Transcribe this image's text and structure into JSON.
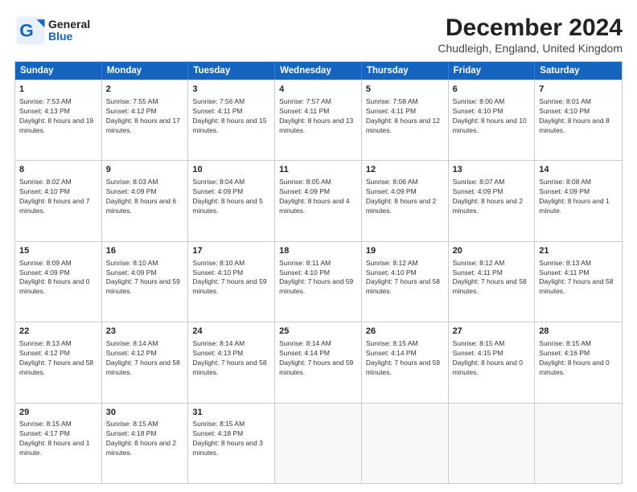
{
  "header": {
    "logo_general": "General",
    "logo_blue": "Blue",
    "main_title": "December 2024",
    "subtitle": "Chudleigh, England, United Kingdom"
  },
  "weekdays": [
    "Sunday",
    "Monday",
    "Tuesday",
    "Wednesday",
    "Thursday",
    "Friday",
    "Saturday"
  ],
  "rows": [
    [
      {
        "day": "1",
        "info": "Sunrise: 7:53 AM\nSunset: 4:13 PM\nDaylight: 8 hours and 19 minutes."
      },
      {
        "day": "2",
        "info": "Sunrise: 7:55 AM\nSunset: 4:12 PM\nDaylight: 8 hours and 17 minutes."
      },
      {
        "day": "3",
        "info": "Sunrise: 7:56 AM\nSunset: 4:11 PM\nDaylight: 8 hours and 15 minutes."
      },
      {
        "day": "4",
        "info": "Sunrise: 7:57 AM\nSunset: 4:11 PM\nDaylight: 8 hours and 13 minutes."
      },
      {
        "day": "5",
        "info": "Sunrise: 7:58 AM\nSunset: 4:11 PM\nDaylight: 8 hours and 12 minutes."
      },
      {
        "day": "6",
        "info": "Sunrise: 8:00 AM\nSunset: 4:10 PM\nDaylight: 8 hours and 10 minutes."
      },
      {
        "day": "7",
        "info": "Sunrise: 8:01 AM\nSunset: 4:10 PM\nDaylight: 8 hours and 8 minutes."
      }
    ],
    [
      {
        "day": "8",
        "info": "Sunrise: 8:02 AM\nSunset: 4:10 PM\nDaylight: 8 hours and 7 minutes."
      },
      {
        "day": "9",
        "info": "Sunrise: 8:03 AM\nSunset: 4:09 PM\nDaylight: 8 hours and 6 minutes."
      },
      {
        "day": "10",
        "info": "Sunrise: 8:04 AM\nSunset: 4:09 PM\nDaylight: 8 hours and 5 minutes."
      },
      {
        "day": "11",
        "info": "Sunrise: 8:05 AM\nSunset: 4:09 PM\nDaylight: 8 hours and 4 minutes."
      },
      {
        "day": "12",
        "info": "Sunrise: 8:06 AM\nSunset: 4:09 PM\nDaylight: 8 hours and 2 minutes."
      },
      {
        "day": "13",
        "info": "Sunrise: 8:07 AM\nSunset: 4:09 PM\nDaylight: 8 hours and 2 minutes."
      },
      {
        "day": "14",
        "info": "Sunrise: 8:08 AM\nSunset: 4:09 PM\nDaylight: 8 hours and 1 minute."
      }
    ],
    [
      {
        "day": "15",
        "info": "Sunrise: 8:09 AM\nSunset: 4:09 PM\nDaylight: 8 hours and 0 minutes."
      },
      {
        "day": "16",
        "info": "Sunrise: 8:10 AM\nSunset: 4:09 PM\nDaylight: 7 hours and 59 minutes."
      },
      {
        "day": "17",
        "info": "Sunrise: 8:10 AM\nSunset: 4:10 PM\nDaylight: 7 hours and 59 minutes."
      },
      {
        "day": "18",
        "info": "Sunrise: 8:11 AM\nSunset: 4:10 PM\nDaylight: 7 hours and 59 minutes."
      },
      {
        "day": "19",
        "info": "Sunrise: 8:12 AM\nSunset: 4:10 PM\nDaylight: 7 hours and 58 minutes."
      },
      {
        "day": "20",
        "info": "Sunrise: 8:12 AM\nSunset: 4:11 PM\nDaylight: 7 hours and 58 minutes."
      },
      {
        "day": "21",
        "info": "Sunrise: 8:13 AM\nSunset: 4:11 PM\nDaylight: 7 hours and 58 minutes."
      }
    ],
    [
      {
        "day": "22",
        "info": "Sunrise: 8:13 AM\nSunset: 4:12 PM\nDaylight: 7 hours and 58 minutes."
      },
      {
        "day": "23",
        "info": "Sunrise: 8:14 AM\nSunset: 4:12 PM\nDaylight: 7 hours and 58 minutes."
      },
      {
        "day": "24",
        "info": "Sunrise: 8:14 AM\nSunset: 4:13 PM\nDaylight: 7 hours and 58 minutes."
      },
      {
        "day": "25",
        "info": "Sunrise: 8:14 AM\nSunset: 4:14 PM\nDaylight: 7 hours and 59 minutes."
      },
      {
        "day": "26",
        "info": "Sunrise: 8:15 AM\nSunset: 4:14 PM\nDaylight: 7 hours and 59 minutes."
      },
      {
        "day": "27",
        "info": "Sunrise: 8:15 AM\nSunset: 4:15 PM\nDaylight: 8 hours and 0 minutes."
      },
      {
        "day": "28",
        "info": "Sunrise: 8:15 AM\nSunset: 4:16 PM\nDaylight: 8 hours and 0 minutes."
      }
    ],
    [
      {
        "day": "29",
        "info": "Sunrise: 8:15 AM\nSunset: 4:17 PM\nDaylight: 8 hours and 1 minute."
      },
      {
        "day": "30",
        "info": "Sunrise: 8:15 AM\nSunset: 4:18 PM\nDaylight: 8 hours and 2 minutes."
      },
      {
        "day": "31",
        "info": "Sunrise: 8:15 AM\nSunset: 4:18 PM\nDaylight: 8 hours and 3 minutes."
      },
      {
        "day": "",
        "info": ""
      },
      {
        "day": "",
        "info": ""
      },
      {
        "day": "",
        "info": ""
      },
      {
        "day": "",
        "info": ""
      }
    ]
  ]
}
